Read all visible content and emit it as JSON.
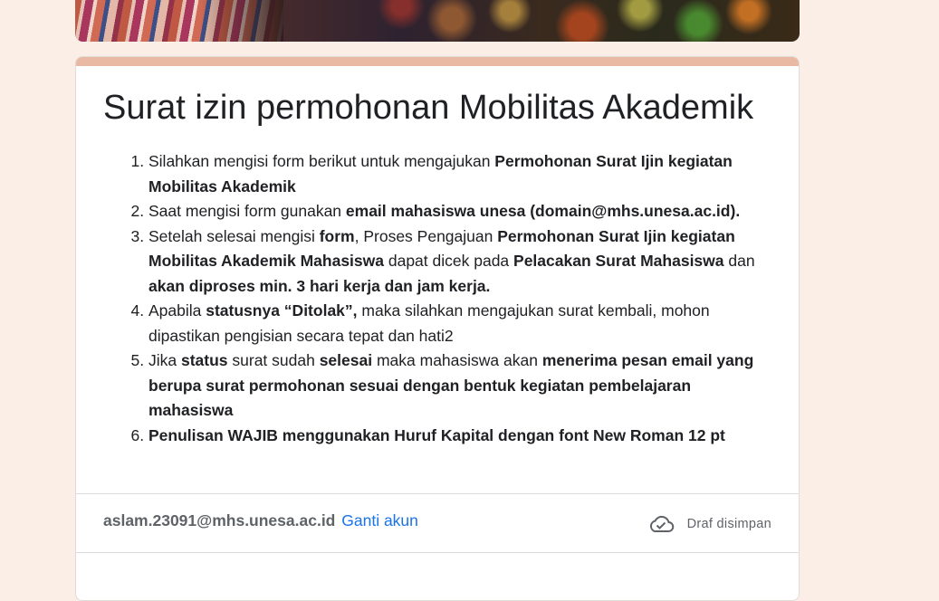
{
  "form": {
    "title": "Surat izin permohonan Mobilitas Akademik",
    "instructions": [
      [
        {
          "t": "Silahkan mengisi form berikut untuk mengajukan ",
          "b": false
        },
        {
          "t": "Permohonan Surat Ijin kegiatan Mobilitas Akademik",
          "b": true
        }
      ],
      [
        {
          "t": "Saat mengisi form gunakan ",
          "b": false
        },
        {
          "t": "email mahasiswa unesa (domain@mhs.unesa.ac.id).",
          "b": true
        }
      ],
      [
        {
          "t": "Setelah selesai mengisi ",
          "b": false
        },
        {
          "t": "form",
          "b": true
        },
        {
          "t": ", Proses Pengajuan ",
          "b": false
        },
        {
          "t": "Permohonan Surat Ijin kegiatan Mobilitas Akademik Mahasiswa",
          "b": true
        },
        {
          "t": " dapat dicek pada ",
          "b": false
        },
        {
          "t": "Pelacakan Surat Mahasiswa",
          "b": true
        },
        {
          "t": "  dan ",
          "b": false
        },
        {
          "t": "akan diproses min. 3 hari kerja dan jam kerja.",
          "b": true
        }
      ],
      [
        {
          "t": "Apabila ",
          "b": false
        },
        {
          "t": "statusnya “Ditolak”,",
          "b": true
        },
        {
          "t": " maka silahkan mengajukan surat kembali, mohon dipastikan pengisian secara tepat dan hati2",
          "b": false
        }
      ],
      [
        {
          "t": "Jika ",
          "b": false
        },
        {
          "t": "status",
          "b": true
        },
        {
          "t": " surat sudah ",
          "b": false
        },
        {
          "t": "selesai",
          "b": true
        },
        {
          "t": "  maka mahasiswa akan ",
          "b": false
        },
        {
          "t": "menerima pesan email yang berupa surat permohonan sesuai dengan bentuk kegiatan pembelajaran mahasiswa",
          "b": true
        }
      ],
      [
        {
          "t": "Penulisan WAJIB menggunakan Huruf Kapital dengan font New Roman 12 pt",
          "b": true
        }
      ]
    ]
  },
  "account": {
    "email": "aslam.23091@mhs.unesa.ac.id",
    "switch_label": "Ganti akun"
  },
  "status": {
    "draft_label": "Draf disimpan",
    "icon": "cloud-check-icon"
  },
  "colors": {
    "page_bg": "#fbeee6",
    "accent": "#e9b9a3",
    "link": "#1a73e8"
  }
}
